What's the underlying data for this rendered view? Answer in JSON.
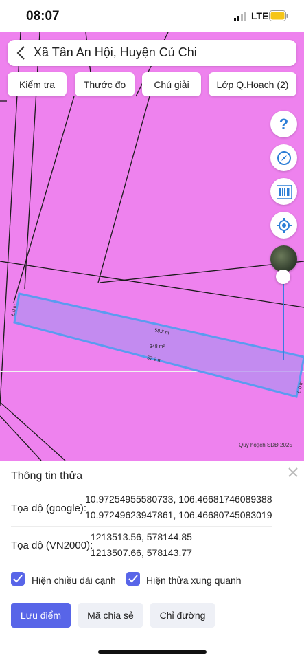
{
  "status_bar": {
    "time": "08:07",
    "network": "LTE",
    "signal_icon": "signal-bars-icon",
    "battery_icon": "battery-icon",
    "battery_color": "#f5c518"
  },
  "header": {
    "title": "Xã Tân An Hội, Huyện Củ Chi",
    "back_icon": "chevron-left-icon"
  },
  "toolbar": {
    "check_label": "Kiểm tra",
    "ruler_label": "Thước đo",
    "legend_label": "Chú giải",
    "layer_label": "Lớp Q.Hoạch (2)"
  },
  "map": {
    "background_color": "#ee82ee",
    "parcel_highlight_color": "#5b9bf0",
    "parcel_labels": {
      "top_edge": "58.2 m",
      "area": "348 m²",
      "bottom_edge": "57.9 m",
      "left_edge": "6.0 m",
      "right_edge": "6.0 m"
    },
    "credit": "Quy hoạch SDĐ 2025",
    "controls": [
      "help-icon",
      "compass-icon",
      "barcode-icon",
      "locate-icon",
      "satellite-thumbnail"
    ],
    "opacity_level": 0.1
  },
  "panel": {
    "title": "Thông tin thửa",
    "google": {
      "label": "Tọa độ (google):",
      "line1": "10.97254955580733, 106.46681746089388",
      "line2": "10.97249623947861, 106.46680745083019"
    },
    "vn2000": {
      "label": "Tọa độ (VN2000):",
      "line1": "1213513.56, 578144.85",
      "line2": "1213507.66, 578143.77"
    },
    "options": {
      "show_edge_length": "Hiện chiều dài cạnh",
      "show_neighbors": "Hiện thửa xung quanh"
    },
    "buttons": {
      "save": "Lưu điểm",
      "share": "Mã chia sẻ",
      "directions": "Chỉ đường"
    },
    "accent_color": "#5865e8"
  }
}
